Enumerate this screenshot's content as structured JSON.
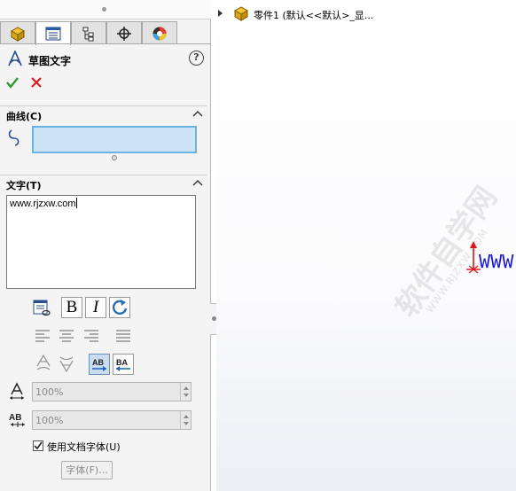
{
  "property_manager": {
    "title": "草图文字",
    "help_icon": "?",
    "tabs": [
      {
        "icon": "feature-manager-icon"
      },
      {
        "icon": "property-manager-icon"
      },
      {
        "icon": "configuration-manager-icon"
      },
      {
        "icon": "dimxpert-icon"
      },
      {
        "icon": "display-manager-icon"
      }
    ],
    "curves_group": {
      "label": "曲线(C)"
    },
    "text_group": {
      "label": "文字(T)",
      "value": "www.rjzxw.com"
    },
    "width_factor": "100%",
    "spacing": "100%",
    "use_doc_font": {
      "label": "使用文档字体(U)",
      "checked": true
    },
    "font_button": "字体(F)..."
  },
  "tree": {
    "label": "零件1  (默认<<默认>_显..."
  },
  "sketch": {
    "text": "www.rjzxw.com",
    "color": "#1a1adc"
  },
  "watermark": {
    "line1": "软件自学网",
    "line2": "WWW.RJZXW.COM"
  },
  "colors": {
    "accent": "#69b4e4",
    "ok": "#2e9b2e",
    "cancel": "#d81e1e"
  }
}
